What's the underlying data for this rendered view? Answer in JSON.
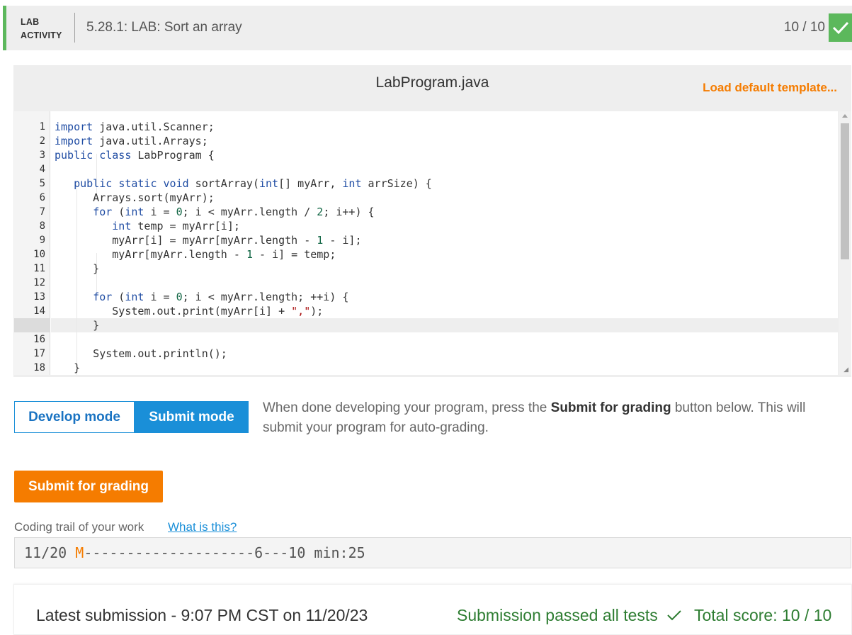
{
  "header": {
    "tag_line1": "LAB",
    "tag_line2": "ACTIVITY",
    "title": "5.28.1: LAB: Sort an array",
    "score": "10 / 10",
    "accent_color": "#5cb85c"
  },
  "editor": {
    "filename": "LabProgram.java",
    "load_template": "Load default template...",
    "active_line": 15,
    "line_numbers": [
      "1",
      "2",
      "3",
      "4",
      "5",
      "6",
      "7",
      "8",
      "9",
      "10",
      "11",
      "12",
      "13",
      "14",
      "15",
      "16",
      "17",
      "18"
    ],
    "lines": [
      "import java.util.Scanner;",
      "import java.util.Arrays;",
      "public class LabProgram {",
      "",
      "   public static void sortArray(int[] myArr, int arrSize) {",
      "      Arrays.sort(myArr);",
      "      for (int i = 0; i < myArr.length / 2; i++) {",
      "         int temp = myArr[i];",
      "         myArr[i] = myArr[myArr.length - 1 - i];",
      "         myArr[myArr.length - 1 - i] = temp;",
      "      }",
      "",
      "      for (int i = 0; i < myArr.length; ++i) {",
      "         System.out.print(myArr[i] + \",\");",
      "      }",
      "",
      "      System.out.println();",
      "   }"
    ]
  },
  "modes": {
    "develop": "Develop mode",
    "submit": "Submit mode",
    "active": "submit",
    "info_prefix": "When done developing your program, press the ",
    "info_bold": "Submit for grading",
    "info_suffix": " button below. This will submit your program for auto-grading."
  },
  "submit_button": "Submit for grading",
  "trail": {
    "label": "Coding trail of your work",
    "link": "What is this?",
    "date": "11/20",
    "marker": "M",
    "rest": "--------------------6---10 min:25"
  },
  "result": {
    "latest": "Latest submission - 9:07 PM CST on 11/20/23",
    "passed": "Submission passed all tests",
    "total": "Total score: 10 / 10"
  },
  "colors": {
    "orange": "#f57c00",
    "blue": "#1a8fd8",
    "green": "#5cb85c",
    "pass_green": "#2e7d32"
  }
}
